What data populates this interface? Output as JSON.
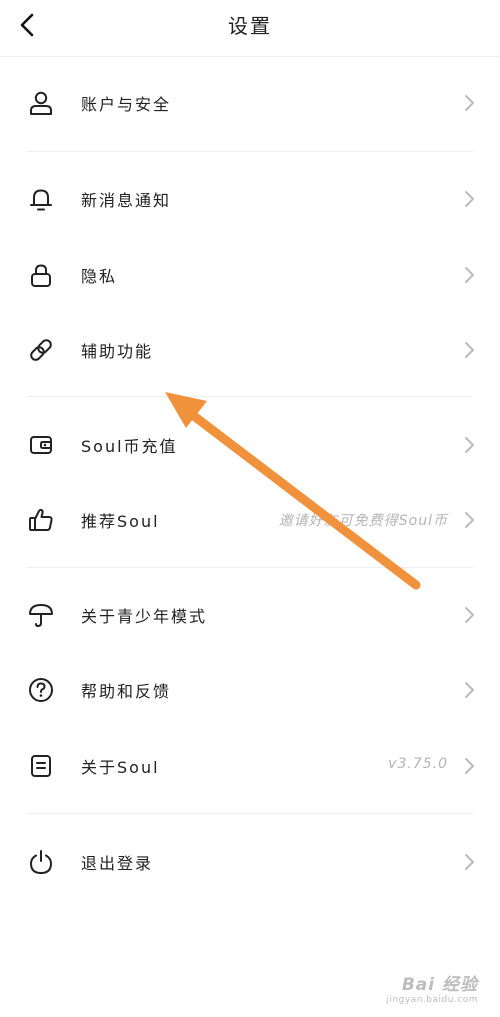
{
  "header": {
    "title": "设置",
    "back_icon": "chevron-left-icon"
  },
  "rows": [
    {
      "id": "account",
      "label": "账户与安全",
      "icon": "user-icon",
      "extra": ""
    },
    {
      "id": "notify",
      "label": "新消息通知",
      "icon": "bell-icon",
      "extra": ""
    },
    {
      "id": "privacy",
      "label": "隐私",
      "icon": "lock-icon",
      "extra": ""
    },
    {
      "id": "accessibility",
      "label": "辅助功能",
      "icon": "link-icon",
      "extra": ""
    },
    {
      "id": "recharge",
      "label": "Soul币充值",
      "icon": "wallet-icon",
      "extra": ""
    },
    {
      "id": "recommend",
      "label": "推荐Soul",
      "icon": "thumbs-up-icon",
      "extra": "邀请好友可免费得Soul币"
    },
    {
      "id": "youth",
      "label": "关于青少年模式",
      "icon": "umbrella-icon",
      "extra": ""
    },
    {
      "id": "help",
      "label": "帮助和反馈",
      "icon": "question-circle-icon",
      "extra": ""
    },
    {
      "id": "about",
      "label": "关于Soul",
      "icon": "document-icon",
      "extra": "v3.75.0"
    },
    {
      "id": "logout",
      "label": "退出登录",
      "icon": "power-icon",
      "extra": ""
    }
  ],
  "annotation": {
    "type": "arrow",
    "color": "#f0913c",
    "target": "辅助功能"
  },
  "watermark": {
    "text": "Bai 经验",
    "sub": "jingyan.baidu.com"
  }
}
